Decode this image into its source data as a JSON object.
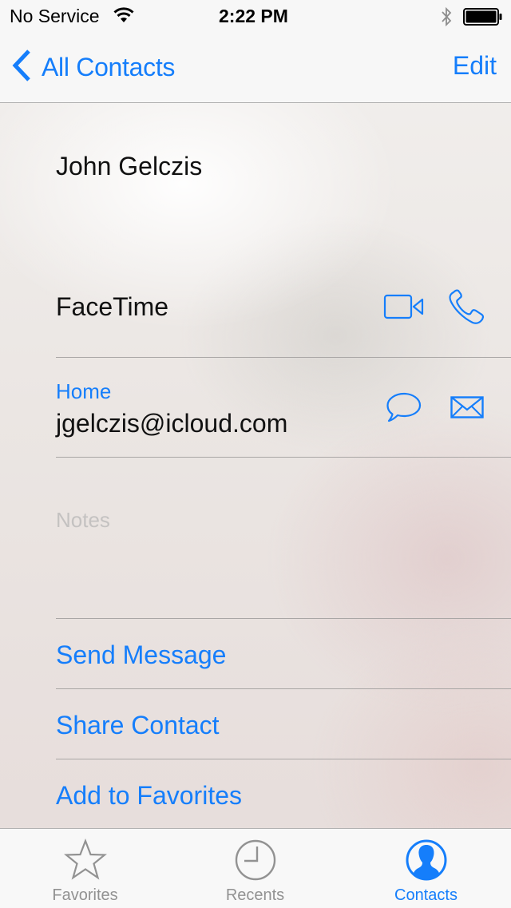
{
  "status_bar": {
    "carrier": "No Service",
    "time": "2:22 PM",
    "icons": [
      "wifi-icon",
      "bluetooth-icon",
      "battery-icon"
    ]
  },
  "nav_bar": {
    "back_label": "All Contacts",
    "back_icon": "chevron-left-icon",
    "edit_label": "Edit"
  },
  "contact": {
    "name": "John Gelczis",
    "facetime": {
      "label": "FaceTime",
      "icons": [
        "video-camera-icon",
        "phone-icon"
      ]
    },
    "email": {
      "label": "Home",
      "value": "jgelczis@icloud.com",
      "icons": [
        "message-bubble-icon",
        "envelope-icon"
      ]
    },
    "notes_placeholder": "Notes"
  },
  "actions": [
    {
      "label": "Send Message"
    },
    {
      "label": "Share Contact"
    },
    {
      "label": "Add to Favorites"
    }
  ],
  "tab_bar": {
    "tabs": [
      {
        "label": "Favorites",
        "icon": "star-icon",
        "active": false
      },
      {
        "label": "Recents",
        "icon": "clock-icon",
        "active": false
      },
      {
        "label": "Contacts",
        "icon": "contact-person-icon",
        "active": true
      }
    ]
  },
  "colors": {
    "accent": "#157efb",
    "inactive_tab": "#929292",
    "placeholder": "#c4c2c1"
  }
}
